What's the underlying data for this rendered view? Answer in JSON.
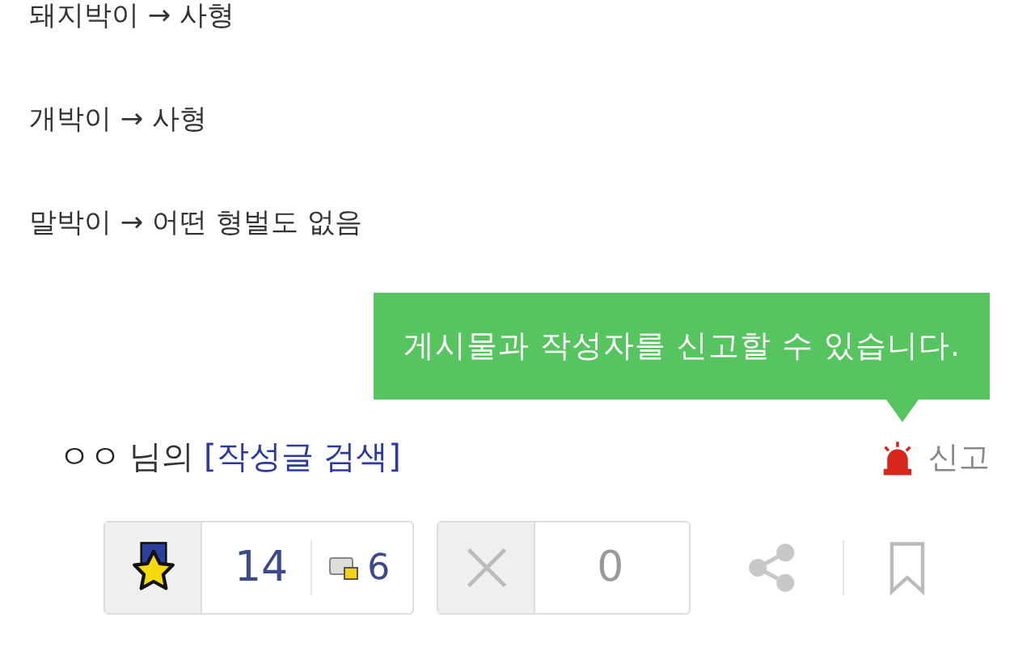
{
  "lines": [
    "돼지박이 → 사형",
    "개박이 → 사형",
    "말박이 → 어떤 형벌도 없음"
  ],
  "tooltip": "게시물과 작성자를 신고할 수 있습니다.",
  "author": {
    "name": "ㅇㅇ",
    "suffix": "님의",
    "link": "[작성글 검색]"
  },
  "report": "신고",
  "recommend": {
    "count": "14",
    "fixed_count": "6"
  },
  "dislike": {
    "count": "0"
  }
}
